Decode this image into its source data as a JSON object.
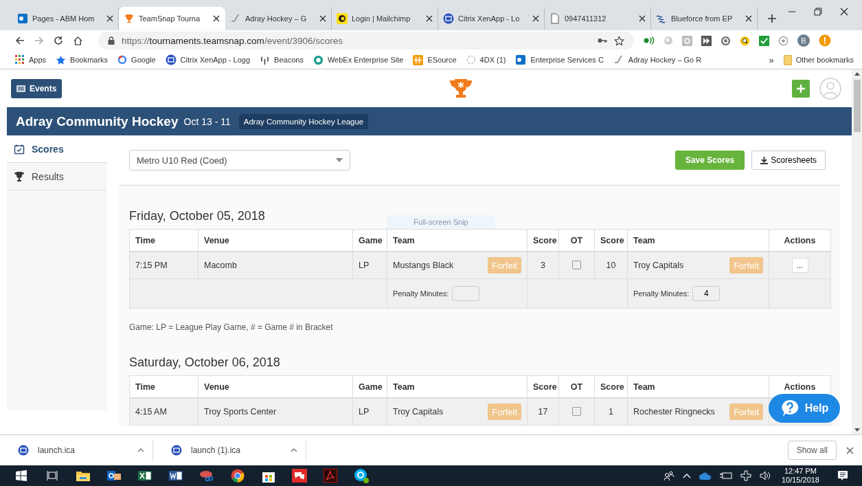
{
  "browser": {
    "tabs": [
      {
        "title": "Pages - ABM Hom",
        "kind": "sharepoint",
        "selected": false
      },
      {
        "title": "TeamSnap Tourna",
        "kind": "trophy",
        "selected": true
      },
      {
        "title": "Adray Hockey – G",
        "kind": "hockey",
        "selected": false
      },
      {
        "title": "Login | Mailchimp",
        "kind": "mailchimp",
        "selected": false
      },
      {
        "title": "Citrix XenApp - Lo",
        "kind": "citrix",
        "selected": false
      },
      {
        "title": "0947411312",
        "kind": "document",
        "selected": false
      },
      {
        "title": "Blueforce from EP",
        "kind": "waves",
        "selected": false
      }
    ],
    "address": {
      "scheme": "https://",
      "host": "tournaments.teamsnap.com",
      "path": "/event/3906/scores"
    },
    "profile_initial": "B",
    "bookmarks": [
      {
        "label": "Apps",
        "kind": "apps"
      },
      {
        "label": "Bookmarks",
        "kind": "star"
      },
      {
        "label": "Google",
        "kind": "google"
      },
      {
        "label": "Citrix XenApp - Logg",
        "kind": "citrix"
      },
      {
        "label": "Beacons",
        "kind": "antenna"
      },
      {
        "label": "WebEx Enterprise Site",
        "kind": "webex"
      },
      {
        "label": "ESource",
        "kind": "grid"
      },
      {
        "label": "4DX (1)",
        "kind": "spinner"
      },
      {
        "label": "Enterprise Services C",
        "kind": "sharepoint"
      },
      {
        "label": "Adray Hockey – Go R",
        "kind": "hockey"
      }
    ],
    "bookmarks_more": "»",
    "other_bookmarks": "Other bookmarks"
  },
  "page": {
    "events_button": "Events",
    "event": {
      "title": "Adray Community Hockey",
      "dates": "Oct 13 - 11",
      "league": "Adray Community Hockey League"
    },
    "sidebar": [
      {
        "label": "Scores",
        "kind": "calendar",
        "selected": true
      },
      {
        "label": "Results",
        "kind": "trophy",
        "selected": false
      }
    ],
    "division": "Metro U10 Red (Coed)",
    "save_button": "Save Scores",
    "scoresheets_button": "Scoresheets",
    "snip_label": "Full-screen Snip",
    "days": [
      {
        "date": "Friday, October 05, 2018",
        "columns": [
          "Time",
          "Venue",
          "Game",
          "Team",
          "Score",
          "OT",
          "Score",
          "Team",
          "Actions"
        ],
        "games": [
          {
            "time": "7:15 PM",
            "venue": "Macomb",
            "game": "LP",
            "overtime": false,
            "actions": "...",
            "home": {
              "team": "Mustangs Black",
              "forfeit": "Forfeit",
              "score": "3",
              "penalty_label": "Penalty Minutes:"
            },
            "away": {
              "team": "Troy Capitals",
              "forfeit": "Forfeit",
              "score": "10",
              "penalty_label": "Penalty Minutes:",
              "penalty": "4"
            }
          }
        ],
        "legend": "Game: LP = League Play Game, # = Game # in Bracket"
      },
      {
        "date": "Saturday, October 06, 2018",
        "columns": [
          "Time",
          "Venue",
          "Game",
          "Team",
          "Score",
          "OT",
          "Score",
          "Team",
          "Actions"
        ],
        "games": [
          {
            "time": "4:15 AM",
            "venue": "Troy Sports Center",
            "game": "LP",
            "overtime": false,
            "home": {
              "team": "Troy Capitals",
              "forfeit": "Forfeit",
              "score": "17"
            },
            "away": {
              "team": "Rochester Ringnecks",
              "forfeit": "Forfeit",
              "score": "1"
            }
          }
        ]
      }
    ],
    "help_button": "Help"
  },
  "downloads": {
    "files": [
      "launch.ica",
      "launch (1).ica"
    ],
    "show_all": "Show all"
  },
  "taskbar": {
    "time": "12:47 PM",
    "date": "10/15/2018"
  }
}
